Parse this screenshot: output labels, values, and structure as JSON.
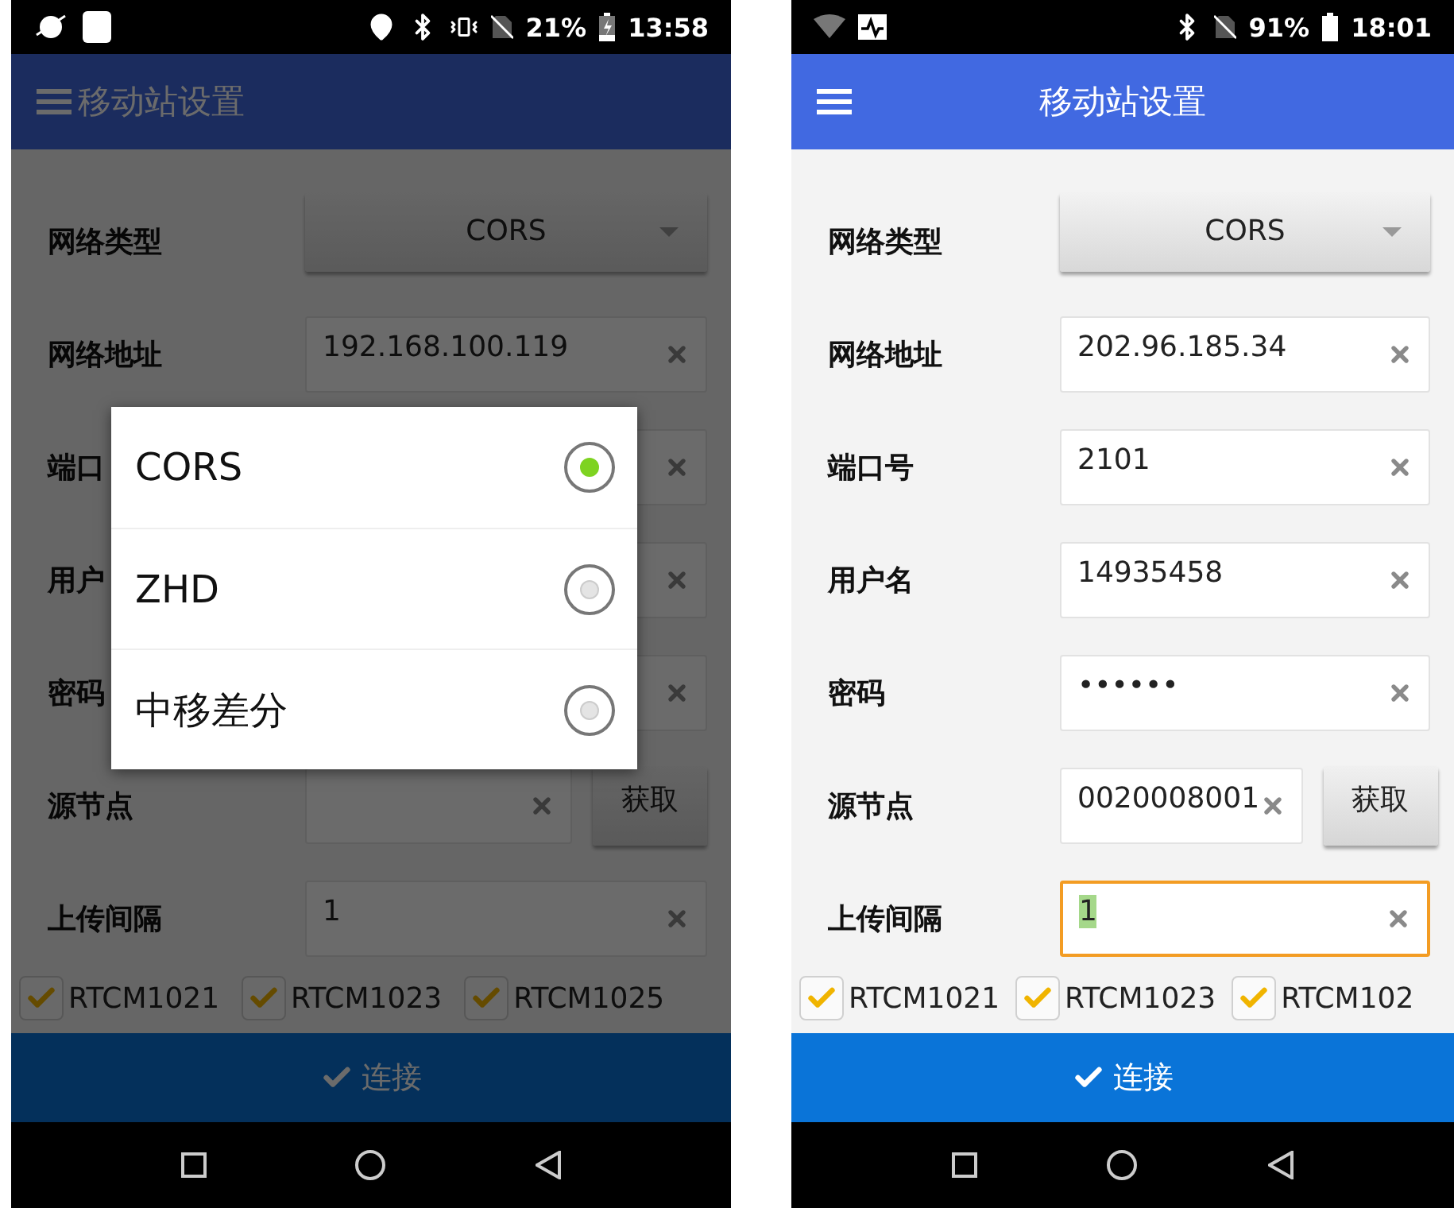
{
  "phones": [
    {
      "status_bar": {
        "battery": "21%",
        "time": "13:58"
      },
      "app_bar": {
        "title": "移动站设置",
        "title_centered": false
      },
      "form": {
        "rows": [
          {
            "kind": "spinner",
            "label": "网络类型",
            "value": "CORS"
          },
          {
            "kind": "field",
            "label": "网络地址",
            "value": "192.168.100.119",
            "focused": false
          },
          {
            "kind": "field",
            "label": "端口",
            "focused": false
          },
          {
            "kind": "field",
            "label": "用户",
            "focused": false
          },
          {
            "kind": "field",
            "label": "密码",
            "focused": false
          },
          {
            "kind": "field_button",
            "label": "源节点",
            "button": "获取",
            "focused": false
          },
          {
            "kind": "field",
            "label": "上传间隔",
            "value": "1",
            "focused": false
          }
        ]
      },
      "checkboxes": [
        {
          "label": "RTCM1021",
          "checked": true
        },
        {
          "label": "RTCM1023",
          "checked": true
        },
        {
          "label": "RTCM1025",
          "checked": true
        }
      ],
      "connect_button": {
        "label": "连接"
      },
      "dialog": {
        "options": [
          {
            "label": "CORS",
            "selected": true
          },
          {
            "label": "ZHD",
            "selected": false
          },
          {
            "label": "中移差分",
            "selected": false
          }
        ]
      }
    },
    {
      "status_bar": {
        "battery": "91%",
        "time": "18:01"
      },
      "app_bar": {
        "title": "移动站设置",
        "title_centered": true
      },
      "form": {
        "rows": [
          {
            "kind": "spinner",
            "label": "网络类型",
            "value": "CORS"
          },
          {
            "kind": "field",
            "label": "网络地址",
            "value": "202.96.185.34",
            "focused": false
          },
          {
            "kind": "field",
            "label": "端口号",
            "value": "2101",
            "focused": false
          },
          {
            "kind": "field",
            "label": "用户名",
            "value": "14935458",
            "focused": false
          },
          {
            "kind": "field",
            "label": "密码",
            "value": "••••••",
            "focused": false
          },
          {
            "kind": "field_button",
            "label": "源节点",
            "value": "0020008001",
            "button": "获取",
            "focused": false
          },
          {
            "kind": "field",
            "label": "上传间隔",
            "value": "1",
            "focused": true
          }
        ]
      },
      "checkboxes": [
        {
          "label": "RTCM1021",
          "checked": true
        },
        {
          "label": "RTCM1023",
          "checked": true
        },
        {
          "label": "RTCM102",
          "checked": true
        }
      ],
      "connect_button": {
        "label": "连接"
      }
    }
  ]
}
